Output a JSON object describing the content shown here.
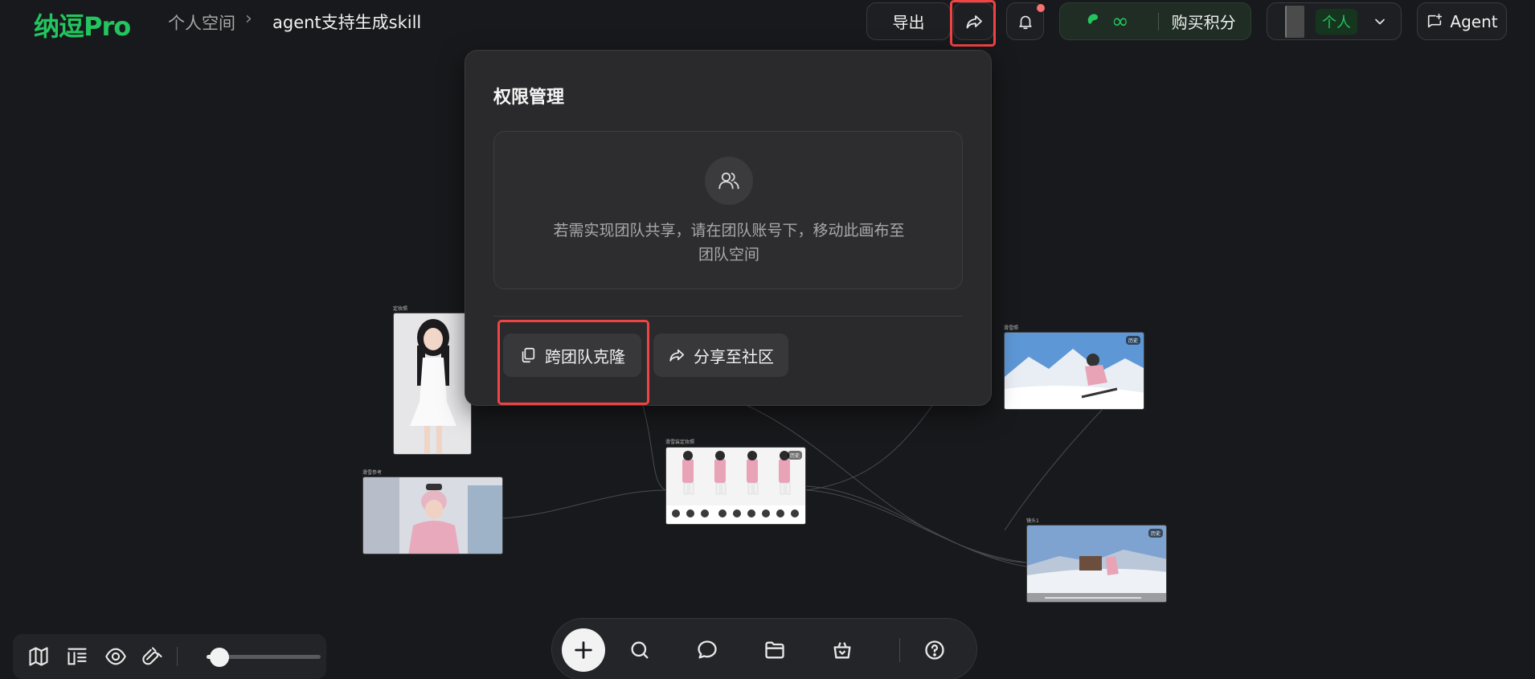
{
  "header": {
    "logo": "纳逗Pro",
    "breadcrumb_space": "个人空间",
    "breadcrumb_sep": "›",
    "canvas_title": "agent支持生成skill",
    "export_label": "导出",
    "credits_unlimited": "∞",
    "buy_credits_label": "购买积分",
    "account_badge": "个人",
    "agent_label": "Agent"
  },
  "popup": {
    "title": "权限管理",
    "card_text_line1": "若需实现团队共享，请在团队账号下，移动此画布至",
    "card_text_line2": "团队空间",
    "clone_label": "跨团队克隆",
    "community_label": "分享至社区"
  },
  "canvas": {
    "nodes": [
      {
        "label": "定妆照"
      },
      {
        "label": "滑雪参考"
      },
      {
        "label": "滑雪装定妆照"
      },
      {
        "label": "滑雪照"
      },
      {
        "label": "镜头1"
      }
    ],
    "history_badge": "历史"
  },
  "colors": {
    "accent": "#22c55e",
    "highlight": "#ef4444",
    "background": "#18191c"
  }
}
